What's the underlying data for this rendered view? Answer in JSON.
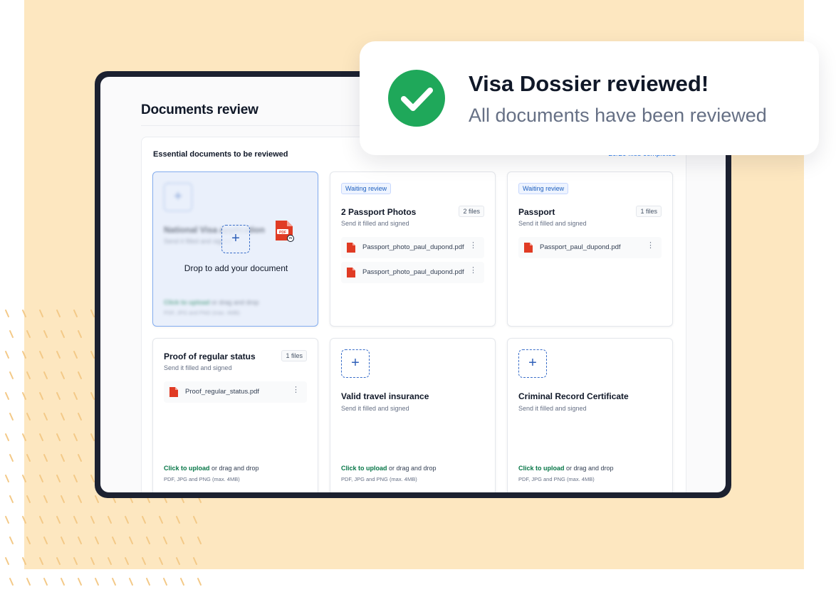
{
  "page": {
    "title": "Documents review",
    "panel_heading": "Essential documents to be reviewed",
    "panel_progress": "20/20 files completed"
  },
  "toast": {
    "title": "Visa Dossier reviewed!",
    "subtitle": "All documents have been reviewed",
    "icon": "check-circle-icon",
    "accent": "#1fa85a"
  },
  "drop_card": {
    "title": "National Visa application",
    "subtitle": "Send it filled and signed",
    "drop_label": "Drop to add your document",
    "upload_link": "Click to upload",
    "upload_rest": " or drag and drop",
    "upload_hint": "PDF, JPG and PNG (max. 4MB)",
    "dragged_file_label": "PDF"
  },
  "cards": [
    {
      "badge": "Waiting review",
      "title": "2 Passport Photos",
      "subtitle": "Send it filled and signed",
      "count": "2 files",
      "files": [
        "Passport_photo_paul_dupond.pdf",
        "Passport_photo_paul_dupond.pdf"
      ]
    },
    {
      "badge": "Waiting review",
      "title": "Passport",
      "subtitle": "Send it filled and signed",
      "count": "1 files",
      "files": [
        "Passport_paul_dupond.pdf"
      ]
    },
    {
      "title": "Proof of regular status",
      "subtitle": "Send it filled and signed",
      "count": "1 files",
      "files": [
        "Proof_regular_status.pdf"
      ],
      "upload_link": "Click to upload",
      "upload_rest": " or drag and drop",
      "upload_hint": "PDF, JPG and PNG (max. 4MB)"
    },
    {
      "title": "Valid travel insurance",
      "subtitle": "Send it filled and signed",
      "upload_link": "Click to upload",
      "upload_rest": " or drag and drop",
      "upload_hint": "PDF, JPG and PNG (max. 4MB)"
    },
    {
      "title": "Criminal Record Certificate",
      "subtitle": "Send it filled and signed",
      "upload_link": "Click to upload",
      "upload_rest": " or drag and drop",
      "upload_hint": "PDF, JPG and PNG (max. 4MB)"
    }
  ],
  "icons": {
    "file": "pdf-file-icon",
    "menu": "kebab-menu-icon",
    "add": "plus-icon"
  },
  "colors": {
    "background": "#fde7c0",
    "device": "#1c2130",
    "link": "#067647",
    "accent_blue": "#3a6ec9",
    "pdf_red": "#e03b24"
  }
}
